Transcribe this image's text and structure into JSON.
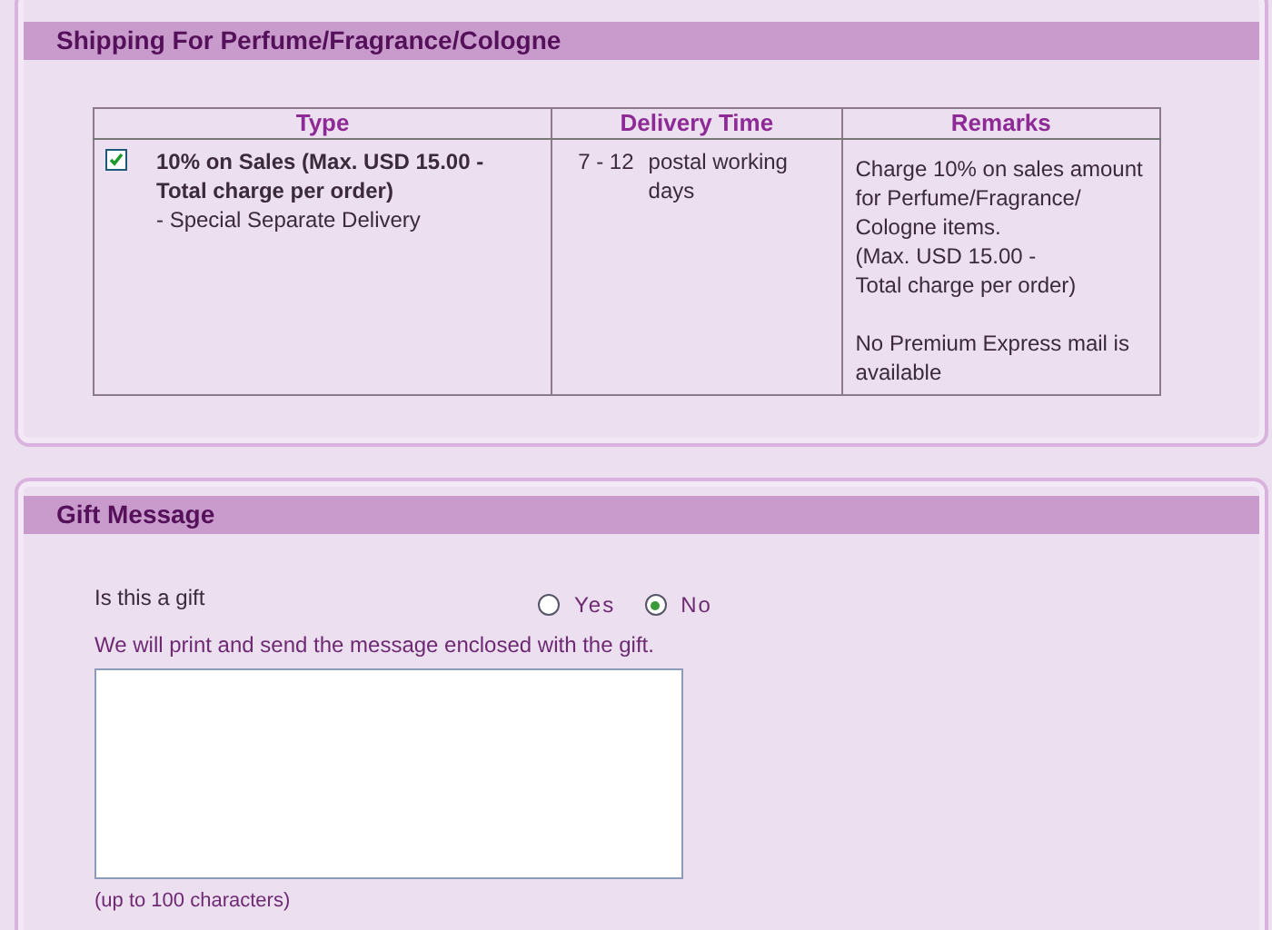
{
  "shipping": {
    "title": "Shipping For Perfume/Fragrance/Cologne",
    "columns": [
      "Type",
      "Delivery Time",
      "Remarks"
    ],
    "rows": [
      {
        "checked": true,
        "type_title": "10% on Sales (Max. USD 15.00 - Total charge per order)",
        "type_note": "- Special Separate Delivery",
        "days": "7 - 12",
        "days_unit": "postal working days",
        "remarks": "Charge 10% on sales amount\nfor Perfume/Fragrance/\nCologne items.\n(Max. USD 15.00 -\nTotal charge per order)\n\nNo Premium Express mail is\navailable"
      }
    ]
  },
  "gift": {
    "title": "Gift Message",
    "question": "Is this a gift",
    "options": [
      {
        "label": "Yes",
        "selected": false
      },
      {
        "label": "No",
        "selected": true
      }
    ],
    "note": "We will print and send the message enclosed with the gift.",
    "limit": "(up to 100 characters)"
  }
}
